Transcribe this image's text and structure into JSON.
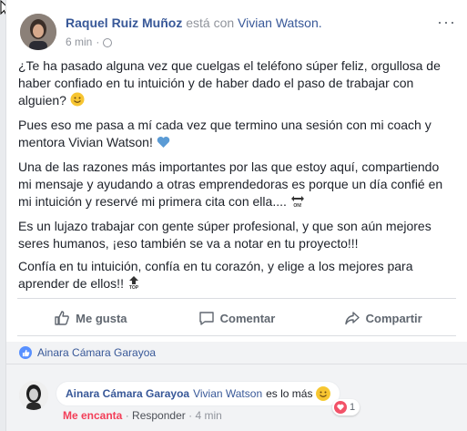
{
  "post": {
    "author": "Raquel Ruiz Muñoz",
    "with_text": "está con",
    "tagged": "Vivian Watson.",
    "time": "6 min",
    "more_icon": "ellipsis-icon",
    "paragraphs": [
      "¿Te ha pasado alguna vez que cuelgas el teléfono súper feliz, orgullosa de haber confiado en tu intuición y de haber dado el paso de trabajar con alguien?",
      "Pues eso me pasa a mí cada vez que termino una sesión con mi coach y mentora Vivian Watson!",
      "Una de las razones más importantes por las que estoy aquí, compartiendo mi mensaje y ayudando a otras emprendedoras es porque un día confié en mi intuición y reservé mi primera cita con ella....",
      "Es un lujazo trabajar con gente súper profesional, y que son aún mejores seres humanos, ¡eso también se va a notar en tu proyecto!!!",
      "Confía en tu intuición, confía en tu corazón, y elige a los mejores para aprender de ellos!!"
    ]
  },
  "actions": {
    "like": "Me gusta",
    "comment": "Comentar",
    "share": "Compartir"
  },
  "reactions": {
    "likers": "Ainara Cámara Garayoa"
  },
  "comment": {
    "author": "Ainara Cámara Garayoa",
    "tag": "Vivian Watson",
    "text": "es lo más",
    "reaction_count": "1",
    "love_label": "Me encanta",
    "reply_label": "Responder",
    "separator": "·",
    "time": "4 min"
  },
  "colors": {
    "link": "#385898",
    "muted": "#90949c",
    "like_blue": "#5890ff",
    "love_red": "#f33e58"
  }
}
